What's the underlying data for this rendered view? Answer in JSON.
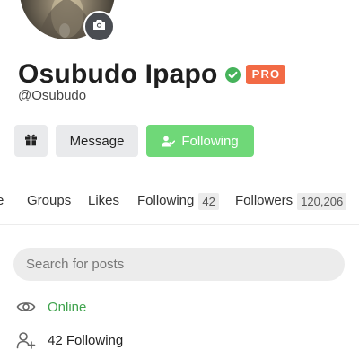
{
  "profile": {
    "display_name": "Osubudo Ipapo",
    "username": "@Osubudo",
    "badge": "PRO",
    "verified": true,
    "avatar_icon": "avatar-photo",
    "camera_icon": "camera-icon"
  },
  "actions": {
    "gift_icon": "gift-icon",
    "message_label": "Message",
    "following_label": "Following",
    "following_icon": "user-check-icon"
  },
  "tabs": [
    {
      "label": "e"
    },
    {
      "label": "Groups"
    },
    {
      "label": "Likes"
    },
    {
      "label": "Following",
      "count": "42"
    },
    {
      "label": "Followers",
      "count": "120,206"
    }
  ],
  "search": {
    "placeholder": "Search for posts",
    "value": ""
  },
  "info": {
    "status": "Online",
    "status_icon": "eye-icon",
    "following_text": "42 Following",
    "following_icon": "user-plus-icon"
  },
  "colors": {
    "accent_green": "#6fd878",
    "online_green": "#3fa34d",
    "pro_badge": "#f26a45",
    "verified": "#46b35b"
  }
}
